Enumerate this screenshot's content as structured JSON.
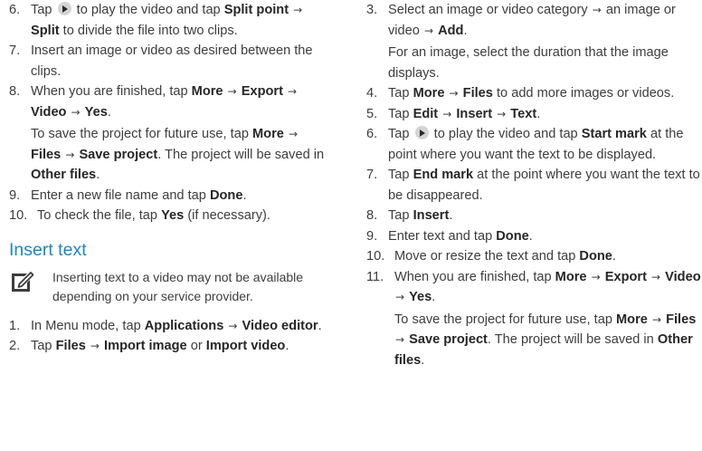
{
  "left": {
    "steps": [
      {
        "num": "6.",
        "parts": [
          [
            "t",
            "Tap "
          ],
          [
            "play",
            ""
          ],
          [
            "t",
            " to play the video and tap "
          ],
          [
            "b",
            "Split point"
          ],
          [
            "t",
            " "
          ],
          [
            "a",
            ""
          ],
          [
            "t",
            " "
          ],
          [
            "b",
            "Split"
          ],
          [
            "t",
            " to divide the file into two clips."
          ]
        ]
      },
      {
        "num": "7.",
        "parts": [
          [
            "t",
            "Insert an image or video as desired between the clips."
          ]
        ]
      },
      {
        "num": "8.",
        "parts": [
          [
            "t",
            "When you are finished, tap "
          ],
          [
            "b",
            "More"
          ],
          [
            "t",
            " "
          ],
          [
            "a",
            ""
          ],
          [
            "t",
            " "
          ],
          [
            "b",
            "Export"
          ],
          [
            "t",
            " "
          ],
          [
            "a",
            ""
          ],
          [
            "t",
            " "
          ],
          [
            "b",
            "Video"
          ],
          [
            "t",
            " "
          ],
          [
            "a",
            ""
          ],
          [
            "t",
            " "
          ],
          [
            "b",
            "Yes"
          ],
          [
            "t",
            "."
          ]
        ],
        "note": [
          [
            "t",
            "To save the project for future use, tap "
          ],
          [
            "b",
            "More"
          ],
          [
            "t",
            " "
          ],
          [
            "a",
            ""
          ],
          [
            "t",
            " "
          ],
          [
            "b",
            "Files"
          ],
          [
            "t",
            " "
          ],
          [
            "a",
            ""
          ],
          [
            "t",
            " "
          ],
          [
            "b",
            "Save project"
          ],
          [
            "t",
            ". The project will be saved in "
          ],
          [
            "b",
            "Other files"
          ],
          [
            "t",
            "."
          ]
        ]
      },
      {
        "num": "9.",
        "parts": [
          [
            "t",
            "Enter a new file name and tap "
          ],
          [
            "b",
            "Done"
          ],
          [
            "t",
            "."
          ]
        ]
      },
      {
        "num": "10.",
        "parts": [
          [
            "t",
            "To check the file, tap "
          ],
          [
            "b",
            "Yes"
          ],
          [
            "t",
            " (if necessary)."
          ]
        ]
      }
    ],
    "heading": "Insert text",
    "note_text": "Inserting text to a video may not be available depending on your service provider.",
    "steps2": [
      {
        "num": "1.",
        "parts": [
          [
            "t",
            "In Menu mode, tap "
          ],
          [
            "b",
            "Applications"
          ],
          [
            "t",
            " "
          ],
          [
            "a",
            ""
          ],
          [
            "t",
            " "
          ],
          [
            "b",
            "Video editor"
          ],
          [
            "t",
            "."
          ]
        ]
      },
      {
        "num": "2.",
        "parts": [
          [
            "t",
            "Tap "
          ],
          [
            "b",
            "Files"
          ],
          [
            "t",
            " "
          ],
          [
            "a",
            ""
          ],
          [
            "t",
            " "
          ],
          [
            "b",
            "Import image"
          ],
          [
            "t",
            " or "
          ],
          [
            "b",
            "Import video"
          ],
          [
            "t",
            "."
          ]
        ]
      }
    ]
  },
  "right": {
    "steps": [
      {
        "num": "3.",
        "parts": [
          [
            "t",
            "Select an image or video category "
          ],
          [
            "a",
            ""
          ],
          [
            "t",
            " an image or video "
          ],
          [
            "a",
            ""
          ],
          [
            "t",
            " "
          ],
          [
            "b",
            "Add"
          ],
          [
            "t",
            "."
          ]
        ],
        "note": [
          [
            "t",
            "For an image, select the duration that the image displays."
          ]
        ]
      },
      {
        "num": "4.",
        "parts": [
          [
            "t",
            "Tap "
          ],
          [
            "b",
            "More"
          ],
          [
            "t",
            " "
          ],
          [
            "a",
            ""
          ],
          [
            "t",
            " "
          ],
          [
            "b",
            "Files"
          ],
          [
            "t",
            " to add more images or videos."
          ]
        ]
      },
      {
        "num": "5.",
        "parts": [
          [
            "t",
            "Tap "
          ],
          [
            "b",
            "Edit"
          ],
          [
            "t",
            " "
          ],
          [
            "a",
            ""
          ],
          [
            "t",
            " "
          ],
          [
            "b",
            "Insert"
          ],
          [
            "t",
            " "
          ],
          [
            "a",
            ""
          ],
          [
            "t",
            " "
          ],
          [
            "b",
            "Text"
          ],
          [
            "t",
            "."
          ]
        ]
      },
      {
        "num": "6.",
        "parts": [
          [
            "t",
            "Tap "
          ],
          [
            "play",
            ""
          ],
          [
            "t",
            " to play the video and tap "
          ],
          [
            "b",
            "Start mark"
          ],
          [
            "t",
            " at the point where you want the text to be displayed."
          ]
        ]
      },
      {
        "num": "7.",
        "parts": [
          [
            "t",
            "Tap "
          ],
          [
            "b",
            "End mark"
          ],
          [
            "t",
            " at the point where you want the text to be disappeared."
          ]
        ]
      },
      {
        "num": "8.",
        "parts": [
          [
            "t",
            "Tap "
          ],
          [
            "b",
            "Insert"
          ],
          [
            "t",
            "."
          ]
        ]
      },
      {
        "num": "9.",
        "parts": [
          [
            "t",
            "Enter text and tap "
          ],
          [
            "b",
            "Done"
          ],
          [
            "t",
            "."
          ]
        ]
      },
      {
        "num": "10.",
        "parts": [
          [
            "t",
            "Move or resize the text and tap "
          ],
          [
            "b",
            "Done"
          ],
          [
            "t",
            "."
          ]
        ]
      },
      {
        "num": "11.",
        "parts": [
          [
            "t",
            "When you are finished, tap "
          ],
          [
            "b",
            "More"
          ],
          [
            "t",
            " "
          ],
          [
            "a",
            ""
          ],
          [
            "t",
            " "
          ],
          [
            "b",
            "Export"
          ],
          [
            "t",
            " "
          ],
          [
            "a",
            ""
          ],
          [
            "t",
            " "
          ],
          [
            "b",
            "Video"
          ],
          [
            "t",
            " "
          ],
          [
            "a",
            ""
          ],
          [
            "t",
            " "
          ],
          [
            "b",
            "Yes"
          ],
          [
            "t",
            "."
          ]
        ],
        "note": [
          [
            "t",
            "To save the project for future use, tap "
          ],
          [
            "b",
            "More"
          ],
          [
            "t",
            " "
          ],
          [
            "a",
            ""
          ],
          [
            "t",
            " "
          ],
          [
            "b",
            "Files"
          ],
          [
            "t",
            " "
          ],
          [
            "a",
            ""
          ],
          [
            "t",
            " "
          ],
          [
            "b",
            "Save project"
          ],
          [
            "t",
            ". The project will be saved in "
          ],
          [
            "b",
            "Other files"
          ],
          [
            "t",
            "."
          ]
        ]
      }
    ]
  },
  "arrow_glyph": "→",
  "colors": {
    "heading": "#1c86c6",
    "body_text": "#3d3d3d",
    "bold_text": "#262626"
  },
  "icons": {
    "note": "note-pencil-icon",
    "play": "play-button-icon"
  }
}
